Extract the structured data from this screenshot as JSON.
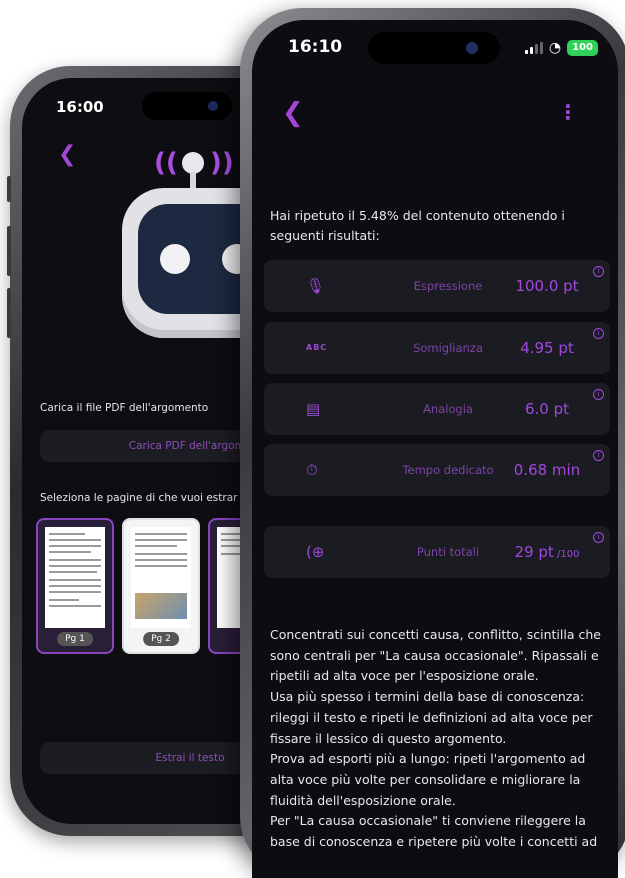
{
  "back_phone": {
    "time": "16:00",
    "upload_label": "Carica il file PDF dell'argomento",
    "upload_button": "Carica PDF dell'argome",
    "pages_label": "Seleziona le pagine di  che vuoi estrar",
    "pages": [
      {
        "label": "Pg 1",
        "selected": true
      },
      {
        "label": "Pg 2",
        "selected": false
      },
      {
        "label": "",
        "selected": false
      }
    ],
    "extract_button": "Estrai il testo"
  },
  "front_phone": {
    "status": {
      "time": "16:10",
      "battery": "100"
    },
    "intro": "Hai ripetuto il 5.48% del contenuto ottenendo i seguenti risultati:",
    "metrics": [
      {
        "icon": "microphone-icon",
        "glyph": "🎙",
        "label": "Espressione",
        "value": "100.0 pt",
        "sub": ""
      },
      {
        "icon": "abc-icon",
        "glyph": "ABC",
        "label": "Somiglianza",
        "value": "4.95 pt",
        "sub": ""
      },
      {
        "icon": "document-icon",
        "glyph": "▤",
        "label": "Analogia",
        "value": "6.0 pt",
        "sub": ""
      },
      {
        "icon": "timer-icon",
        "glyph": "⏱",
        "label": "Tempo dedicato",
        "value": "0.68 min",
        "sub": ""
      },
      {
        "icon": "add-circle-icon",
        "glyph": "(⊕",
        "label": "Punti totali",
        "value": "29 pt",
        "sub": " /100"
      }
    ],
    "advice": [
      "Concentrati sui concetti causa, conflitto, scintilla che sono centrali per \"La causa occasionale\". Ripassali e ripetili ad alta voce per l'esposizione orale.",
      "Usa più spesso i termini della base di conoscenza: rileggi il testo e ripeti le definizioni ad alta voce per fissare il lessico di questo argomento.",
      "Prova ad esporti più a lungo: ripeti l'argomento ad alta voce più volte per consolidare e migliorare la fluidità dell'esposizione orale.",
      "Per \"La causa occasionale\" ti conviene rileggere la base di conoscenza e ripetere più volte i concetti ad"
    ]
  },
  "colors": {
    "accent": "#a048e0",
    "card": "#1b1b22",
    "screen": "#0c0c12"
  }
}
